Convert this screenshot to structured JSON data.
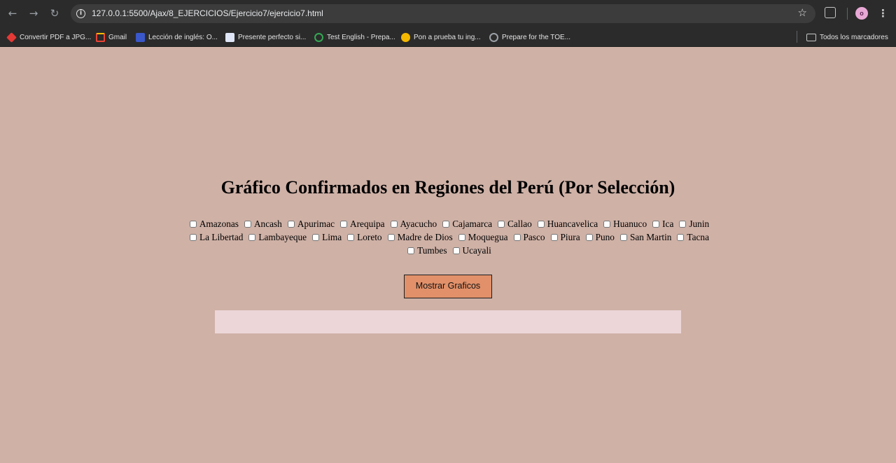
{
  "browser": {
    "url": "127.0.0.1:5500/Ajax/8_EJERCICIOS/Ejercicio7/ejercicio7.html",
    "nav_icons": {
      "back": "arrow-left-icon",
      "forward": "arrow-right-icon",
      "reload": "reload-icon"
    },
    "avatar_letter": "o",
    "bookmarks": [
      {
        "label": "Convertir PDF a JPG...",
        "icon_color": "#e53935"
      },
      {
        "label": "Gmail",
        "icon_color": "#ea4335"
      },
      {
        "label": "Lección de inglés: O...",
        "icon_color": "#3a58c9"
      },
      {
        "label": "Presente perfecto si...",
        "icon_color": "#8fa8e0"
      },
      {
        "label": "Test English - Prepa...",
        "icon_color": "#34a853"
      },
      {
        "label": "Pon a prueba tu ing...",
        "icon_color": "#f5b800"
      },
      {
        "label": "Prepare for the TOE...",
        "icon_color": "#9aa0a6"
      }
    ],
    "all_bookmarks_label": "Todos los marcadores"
  },
  "page": {
    "title": "Gráfico Confirmados en Regiones del Perú (Por Selección)",
    "regions": [
      "Amazonas",
      "Ancash",
      "Apurimac",
      "Arequipa",
      "Ayacucho",
      "Cajamarca",
      "Callao",
      "Huancavelica",
      "Huanuco",
      "Ica",
      "Junin",
      "La Libertad",
      "Lambayeque",
      "Lima",
      "Loreto",
      "Madre de Dios",
      "Moquegua",
      "Pasco",
      "Piura",
      "Puno",
      "San Martin",
      "Tacna",
      "Tumbes",
      "Ucayali"
    ],
    "button_label": "Mostrar Graficos",
    "colors": {
      "background": "#cfb1a6",
      "button": "#e19069",
      "chart_area": "#ecd6d8"
    }
  }
}
